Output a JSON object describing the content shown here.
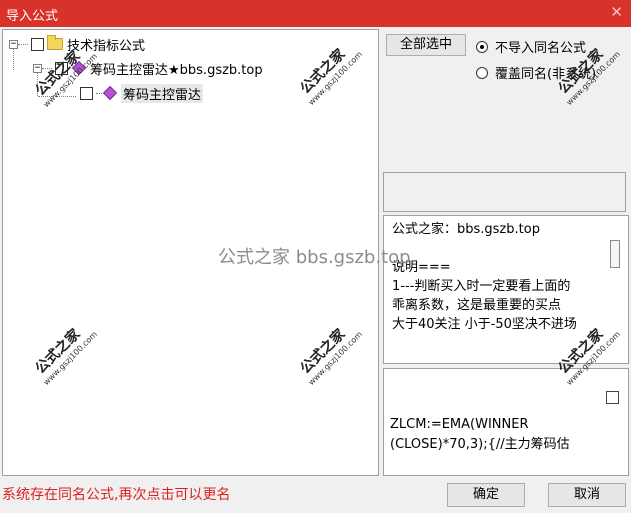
{
  "window": {
    "title": "导入公式",
    "close_glyph": "✕"
  },
  "tree": {
    "root": {
      "label": "技术指标公式",
      "expander": "−",
      "checked": false
    },
    "child": {
      "label": "筹码主控雷达★bbs.gszb.top",
      "expander": "−",
      "checked": false
    },
    "leaf": {
      "label": "筹码主控雷达",
      "checked": false
    }
  },
  "buttons": {
    "select_all": "全部选中",
    "ok": "确定",
    "cancel": "取消"
  },
  "options": {
    "no_import": "不导入同名公式",
    "overwrite": "覆盖同名(非系统)",
    "selected": "no_import"
  },
  "description": {
    "lines": [
      "公式之家：bbs.gszb.top",
      "",
      "说明===",
      "1---判断买入时一定要看上面的",
      "乖离系数，这是最重要的买点",
      "大于40关注 小于-50坚决不进场"
    ]
  },
  "code": {
    "lines": [
      "ZLCM:=EMA(WINNER",
      "(CLOSE)*70,3);{//主力筹码估"
    ]
  },
  "status_message": "系统存在同名公式,再次点击可以更名",
  "watermark": {
    "center_text": "公式之家 bbs.gszb.top",
    "stamp_big": "公式之家",
    "stamp_small": "www.gszj100.com"
  },
  "colors": {
    "titlebar": "#d9322b",
    "status_text": "#e02020"
  }
}
